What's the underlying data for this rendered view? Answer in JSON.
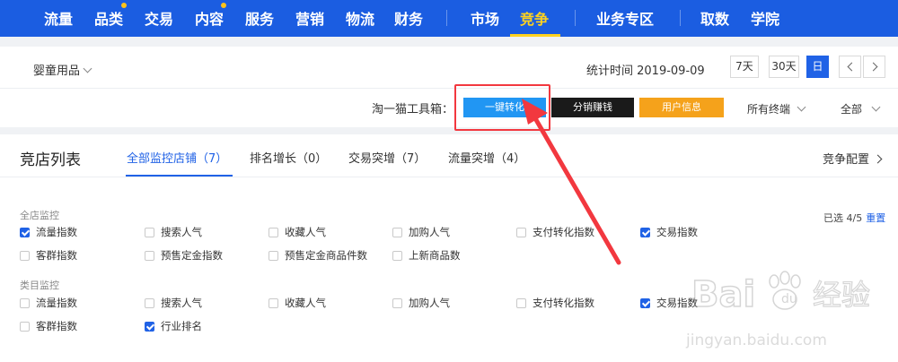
{
  "top_nav": {
    "items": [
      "流量",
      "品类",
      "交易",
      "内容",
      "服务",
      "营销",
      "物流",
      "财务",
      "市场",
      "竞争",
      "业务专区",
      "取数",
      "学院"
    ],
    "active": "竞争",
    "badge_items": [
      "品类",
      "内容"
    ],
    "colors": {
      "bar": "#1b5de1",
      "active": "#ffd21f",
      "badge": "#ffc21a"
    }
  },
  "filter_bar": {
    "category": "婴童用品",
    "stat_time": "统计时间 2019-09-09",
    "periods": [
      "7天",
      "30天",
      "日"
    ],
    "active_period": "日",
    "prev_icon": "chevron-left-icon",
    "next_icon": "chevron-right-icon"
  },
  "toolbox": {
    "label": "淘一猫工具箱：",
    "buttons": [
      {
        "label": "一键转化",
        "color": "#2196f3"
      },
      {
        "label": "分销赚钱",
        "color": "#1a1a1a"
      },
      {
        "label": "用户信息",
        "color": "#f5a21b"
      }
    ],
    "terminal_filter": "所有终端",
    "scope_filter": "全部"
  },
  "competitor_list": {
    "title": "竞店列表",
    "tabs": [
      "全部监控店铺（7）",
      "排名增长（0）",
      "交易突增（7）",
      "流量突增（4）"
    ],
    "active_tab": 0,
    "config_label": "竞争配置",
    "selected_count": "已选 4/5",
    "reset_label": "重置",
    "groups": [
      {
        "label": "全店监控",
        "rows": [
          [
            {
              "label": "流量指数",
              "checked": true
            },
            {
              "label": "搜索人气",
              "checked": false
            },
            {
              "label": "收藏人气",
              "checked": false
            },
            {
              "label": "加购人气",
              "checked": false
            },
            {
              "label": "支付转化指数",
              "checked": false
            },
            {
              "label": "交易指数",
              "checked": true
            }
          ],
          [
            {
              "label": "客群指数",
              "checked": false
            },
            {
              "label": "预售定金指数",
              "checked": false
            },
            {
              "label": "预售定金商品件数",
              "checked": false
            },
            {
              "label": "上新商品数",
              "checked": false
            }
          ]
        ]
      },
      {
        "label": "类目监控",
        "rows": [
          [
            {
              "label": "流量指数",
              "checked": false
            },
            {
              "label": "搜索人气",
              "checked": false
            },
            {
              "label": "收藏人气",
              "checked": false
            },
            {
              "label": "加购人气",
              "checked": false
            },
            {
              "label": "支付转化指数",
              "checked": false
            },
            {
              "label": "交易指数",
              "checked": true
            }
          ],
          [
            {
              "label": "客群指数",
              "checked": false
            },
            {
              "label": "行业排名",
              "checked": true
            }
          ]
        ]
      }
    ]
  },
  "watermark": {
    "brand": "Baidu",
    "brand_cn": "经验",
    "url": "jingyan.baidu.com"
  },
  "annotation_color": "#f2383f"
}
